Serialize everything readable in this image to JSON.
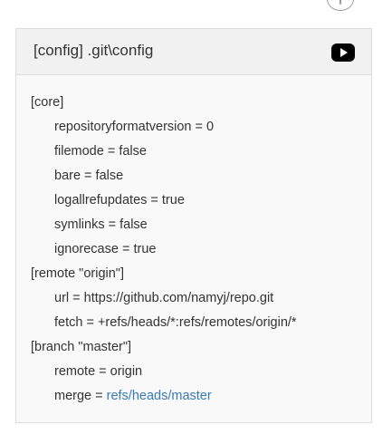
{
  "panel": {
    "title": "[config] .git\\config"
  },
  "code": {
    "lines": [
      "[core]",
      "repositoryformatversion = 0",
      "filemode = false",
      "bare = false",
      "logallrefupdates = true",
      "symlinks = false",
      "ignorecase = true",
      "[remote \"origin\"]",
      "url = https://github.com/namyj/repo.git",
      "fetch = +refs/heads/*:refs/remotes/origin/*",
      "[branch \"master\"]",
      "remote = origin",
      "merge = "
    ],
    "merge_link": "refs/heads/master"
  },
  "icons": {
    "top": "info-circle-icon",
    "header_button": "play-icon"
  },
  "colors": {
    "link": "#3a78b5",
    "header_bg": "#f1f1f1",
    "body_bg": "#f9f9f9",
    "border": "#dcdcdc"
  }
}
